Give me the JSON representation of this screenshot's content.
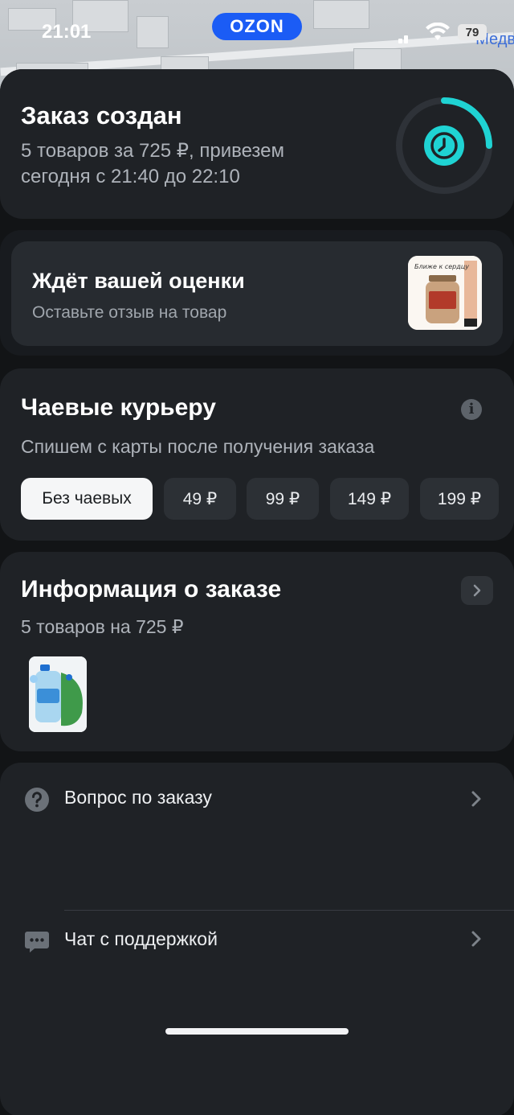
{
  "status_bar": {
    "time": "21:01",
    "brand": "OZON",
    "battery": "79",
    "map_label": "Медв"
  },
  "order": {
    "title": "Заказ создан",
    "subtitle": "5 товаров за 725 ₽, привезем сегодня с 21:40 до 22:10",
    "progress_color": "#1fd3d3",
    "icon": "clock-icon"
  },
  "review": {
    "title": "Ждёт вашей оценки",
    "subtitle": "Оставьте отзыв на товар",
    "thumb_text": "Ближе к сердцу"
  },
  "tips": {
    "title": "Чаевые курьеру",
    "subtitle": "Спишем с карты после получения заказа",
    "options": [
      {
        "label": "Без чаевых",
        "selected": true
      },
      {
        "label": "49 ₽",
        "selected": false
      },
      {
        "label": "99 ₽",
        "selected": false
      },
      {
        "label": "149 ₽",
        "selected": false
      },
      {
        "label": "199 ₽",
        "selected": false
      }
    ]
  },
  "info": {
    "title": "Информация о заказе",
    "subtitle": "5 товаров на 725 ₽"
  },
  "actions": {
    "question": {
      "label": "Вопрос по заказу",
      "icon": "question-icon"
    },
    "chat": {
      "label": "Чат с поддержкой",
      "icon": "chat-icon"
    }
  },
  "colors": {
    "accent": "#1fd3d3",
    "brand": "#1b5cf5",
    "card": "#1f2226"
  }
}
